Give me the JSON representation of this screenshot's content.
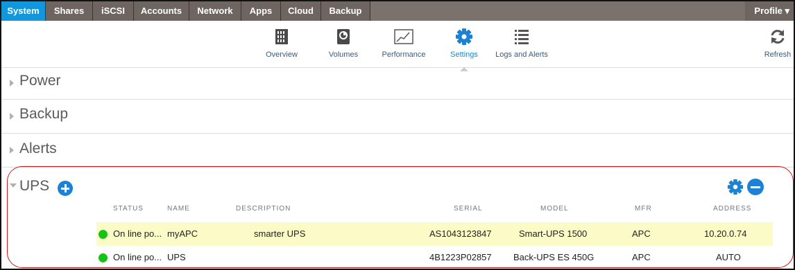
{
  "nav": {
    "tabs": [
      "System",
      "Shares",
      "iSCSI",
      "Accounts",
      "Network",
      "Apps",
      "Cloud",
      "Backup"
    ],
    "active": "System",
    "profile": "Profile ▾"
  },
  "toolbar": {
    "items": [
      {
        "label": "Overview",
        "icon": "overview-icon"
      },
      {
        "label": "Volumes",
        "icon": "volumes-icon"
      },
      {
        "label": "Performance",
        "icon": "performance-icon"
      },
      {
        "label": "Settings",
        "icon": "settings-gear-icon"
      },
      {
        "label": "Logs and Alerts",
        "icon": "logs-list-icon"
      }
    ],
    "active": "Settings",
    "refresh": "Refresh"
  },
  "sections": [
    "Power",
    "Backup",
    "Alerts"
  ],
  "ups": {
    "title": "UPS",
    "columns": [
      "STATUS",
      "NAME",
      "DESCRIPTION",
      "SERIAL",
      "MODEL",
      "MFR",
      "ADDRESS"
    ],
    "rows": [
      {
        "status": "On line po...",
        "name": "myAPC",
        "description": "smarter UPS",
        "serial": "AS1043123847",
        "model": "Smart-UPS 1500",
        "mfr": "APC",
        "address": "10.20.0.74",
        "selected": true
      },
      {
        "status": "On line po...",
        "name": "UPS",
        "description": "",
        "serial": "4B1223P02857",
        "model": "Back-UPS ES 450G",
        "mfr": "APC",
        "address": "AUTO",
        "selected": false
      }
    ]
  },
  "colors": {
    "accent": "#1d82d4",
    "nav_bg": "#6e6460",
    "active_tab": "#1296dc",
    "status_ok": "#17c217",
    "selected_row": "#fbfbc8",
    "callout": "#d0161a"
  }
}
